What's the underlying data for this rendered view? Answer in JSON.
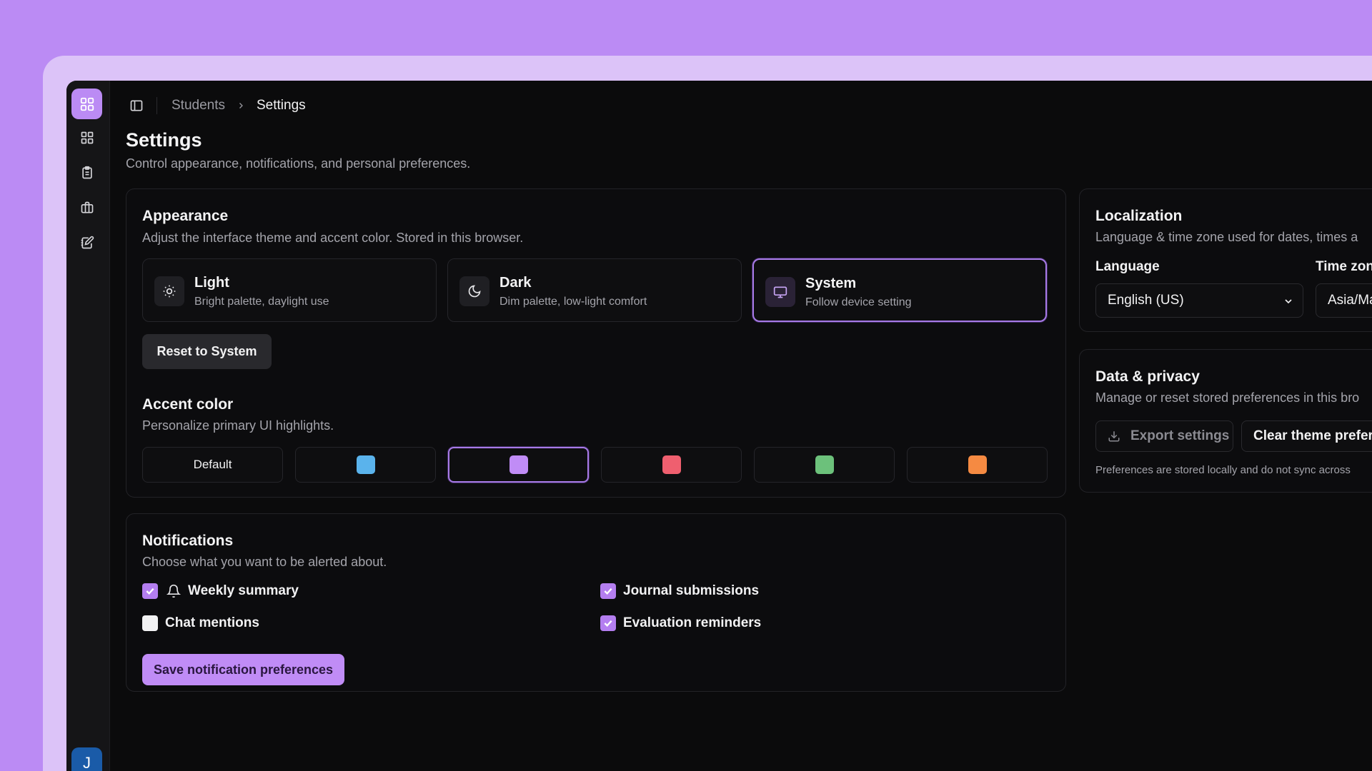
{
  "breadcrumb": {
    "parent": "Students",
    "current": "Settings"
  },
  "page": {
    "title": "Settings",
    "subtitle": "Control appearance, notifications, and personal preferences."
  },
  "appearance": {
    "title": "Appearance",
    "subtitle": "Adjust the interface theme and accent color. Stored in this browser.",
    "themes": [
      {
        "name": "Light",
        "desc": "Bright palette, daylight use",
        "icon": "sun-icon"
      },
      {
        "name": "Dark",
        "desc": "Dim palette, low-light comfort",
        "icon": "moon-icon"
      },
      {
        "name": "System",
        "desc": "Follow device setting",
        "icon": "monitor-icon",
        "selected": true
      }
    ],
    "reset_label": "Reset to System",
    "accent_title": "Accent color",
    "accent_subtitle": "Personalize primary UI highlights.",
    "accents": [
      {
        "label": "Default"
      },
      {
        "color": "#5ab3ec"
      },
      {
        "color": "#c08cf6",
        "selected": true
      },
      {
        "color": "#ef5f6f"
      },
      {
        "color": "#6cc17b"
      },
      {
        "color": "#f58a42"
      }
    ]
  },
  "notifications": {
    "title": "Notifications",
    "subtitle": "Choose what you want to be alerted about.",
    "items": [
      {
        "label": "Weekly summary",
        "checked": true,
        "icon": "bell-icon"
      },
      {
        "label": "Chat mentions",
        "checked": false
      },
      {
        "label": "Journal submissions",
        "checked": true
      },
      {
        "label": "Evaluation reminders",
        "checked": true
      }
    ],
    "save_label": "Save notification preferences"
  },
  "localization": {
    "title": "Localization",
    "subtitle": "Language & time zone used for dates, times a",
    "language_label": "Language",
    "language_value": "English (US)",
    "timezone_label": "Time zon",
    "timezone_value": "Asia/Ma"
  },
  "privacy": {
    "title": "Data & privacy",
    "subtitle": "Manage or reset stored preferences in this bro",
    "export_label": "Export settings",
    "clear_label": "Clear theme prefere",
    "note": "Preferences are stored locally and do not sync across"
  },
  "user": {
    "avatar_initial": "J"
  },
  "colors": {
    "accent": "#c08cf6",
    "background": "#0b0b0c",
    "avatar": "#1a5ba8"
  }
}
